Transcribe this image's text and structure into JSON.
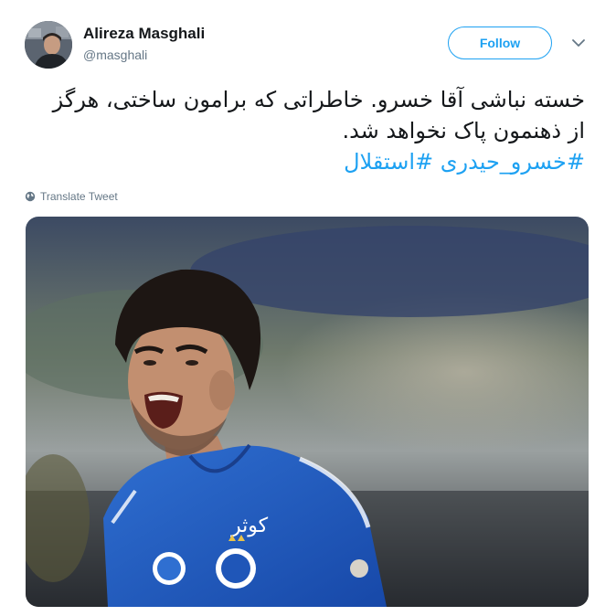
{
  "author": {
    "display_name": "Alireza Masghali",
    "username": "@masghali"
  },
  "header": {
    "follow_label": "Follow",
    "caret_icon": "chevron-down-icon"
  },
  "tweet": {
    "line1": "خسته نباشی آقا خسرو. خاطراتی که برامون ساختی، هرگز",
    "line2": "از ذهنمون پاک نخواهد شد.",
    "hashtags": [
      "#خسرو_حیدری",
      "#استقلال"
    ]
  },
  "translate": {
    "label": "Translate Tweet",
    "icon": "globe-icon"
  },
  "media": {
    "description_icon": "football-player-photo",
    "shirt_text": "کوثر"
  },
  "colors": {
    "accent": "#1da1f2",
    "secondary_text": "#657786",
    "primary_text": "#14171a"
  }
}
